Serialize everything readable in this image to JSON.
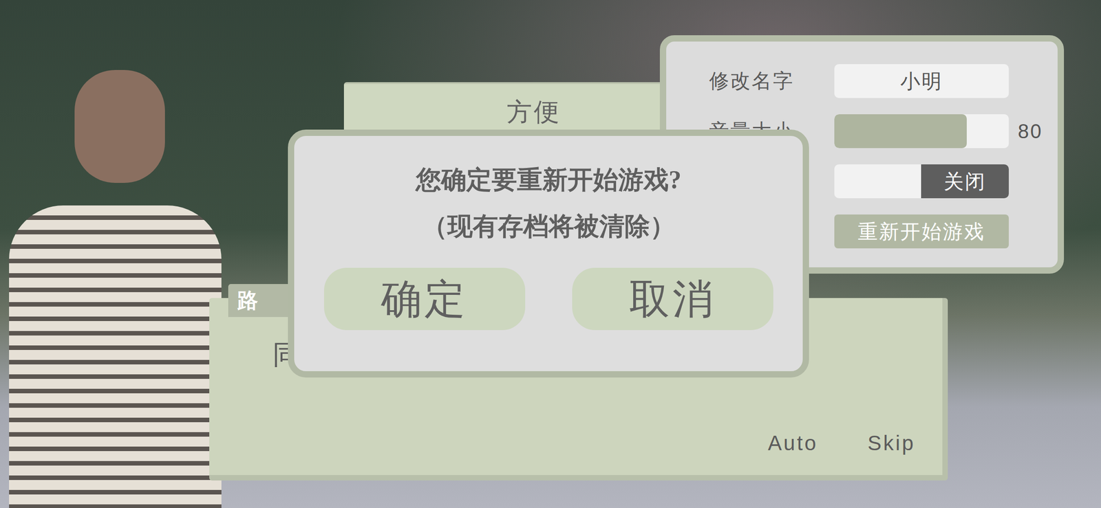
{
  "settings": {
    "rows": [
      {
        "kind": "text",
        "label": "修改名字",
        "value": "小明"
      },
      {
        "kind": "slider",
        "label": "音量大小",
        "level": 0.76,
        "reading": "80"
      },
      {
        "kind": "toggle",
        "on": false,
        "value": "关闭"
      },
      {
        "kind": "button",
        "value": "重新开始游戏"
      }
    ]
  },
  "choices": [
    {
      "label": "方便"
    }
  ],
  "dialog_box": {
    "speaker": "路",
    "text": "同",
    "buttons": [
      "Auto",
      "Skip"
    ]
  },
  "confirm": {
    "title": "您确定要重新开始游戏?",
    "subtitle": "（现有存档将被清除）",
    "buttons": [
      "确定",
      "取消"
    ]
  }
}
